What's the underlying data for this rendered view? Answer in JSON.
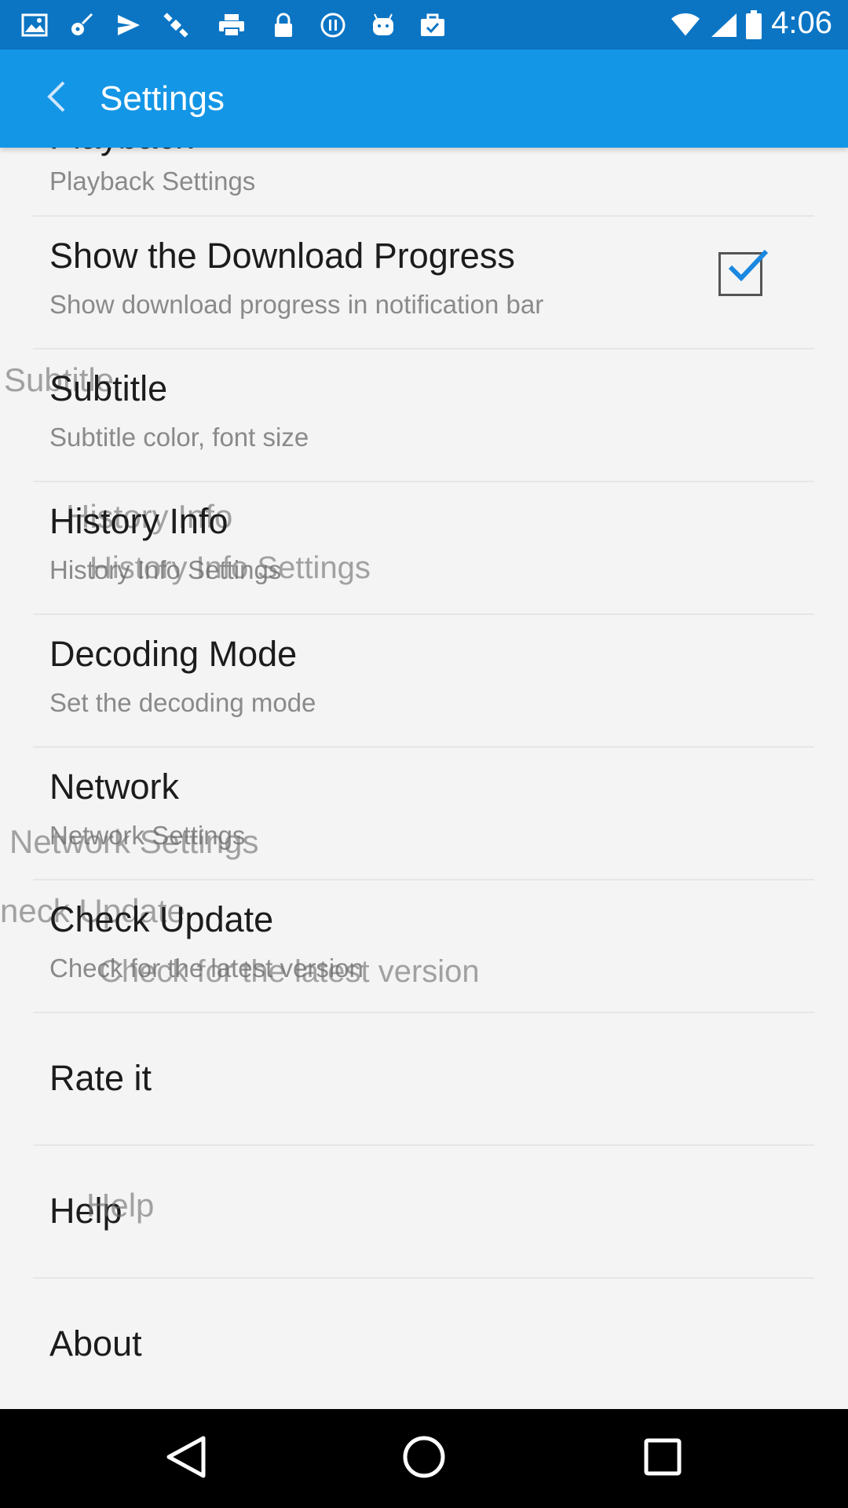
{
  "status_bar": {
    "time": "4:06",
    "left_icons": [
      "image-icon",
      "guitar-icon",
      "send-icon",
      "satellite-icon",
      "printer-icon",
      "lock-icon",
      "pause-icon",
      "android-icon",
      "briefcase-check-icon"
    ],
    "right_icons": [
      "wifi-icon",
      "signal-icon",
      "battery-icon"
    ]
  },
  "app_bar": {
    "title": "Settings",
    "back_icon": "back-arrow-icon",
    "color": "#1496e6"
  },
  "settings": [
    {
      "id": "playback",
      "title": "Playback",
      "summary": "Playback Settings"
    },
    {
      "id": "download-progress",
      "title": "Show the Download Progress",
      "summary": "Show download progress in notification bar",
      "checked": true
    },
    {
      "id": "subtitle",
      "title": "Subtitle",
      "summary": "Subtitle color, font size"
    },
    {
      "id": "history-info",
      "title": "History Info",
      "summary": "History Info Settings"
    },
    {
      "id": "decoding-mode",
      "title": "Decoding Mode",
      "summary": "Set the decoding mode"
    },
    {
      "id": "network",
      "title": "Network",
      "summary": "Network Settings"
    },
    {
      "id": "check-update",
      "title": "Check Update",
      "summary": "Check for the latest version"
    },
    {
      "id": "rate-it",
      "title": "Rate it"
    },
    {
      "id": "help",
      "title": "Help"
    },
    {
      "id": "about",
      "title": "About"
    }
  ],
  "ghost_texts": {
    "subtitle": "Subtitle",
    "history_title": "History Info",
    "history_summary": "History Info Settings",
    "network_summary": "Network Settings",
    "check_update_title": "neck Update",
    "check_update_summary": "Check for the latest version",
    "help": "Help"
  },
  "nav_bar": {
    "back_icon": "nav-back-icon",
    "home_icon": "nav-home-icon",
    "recents_icon": "nav-recents-icon"
  },
  "colors": {
    "status_bar": "#0b75c4",
    "app_bar": "#1496e6",
    "checkbox_tick": "#1a88e0",
    "background": "#f4f4f4"
  }
}
